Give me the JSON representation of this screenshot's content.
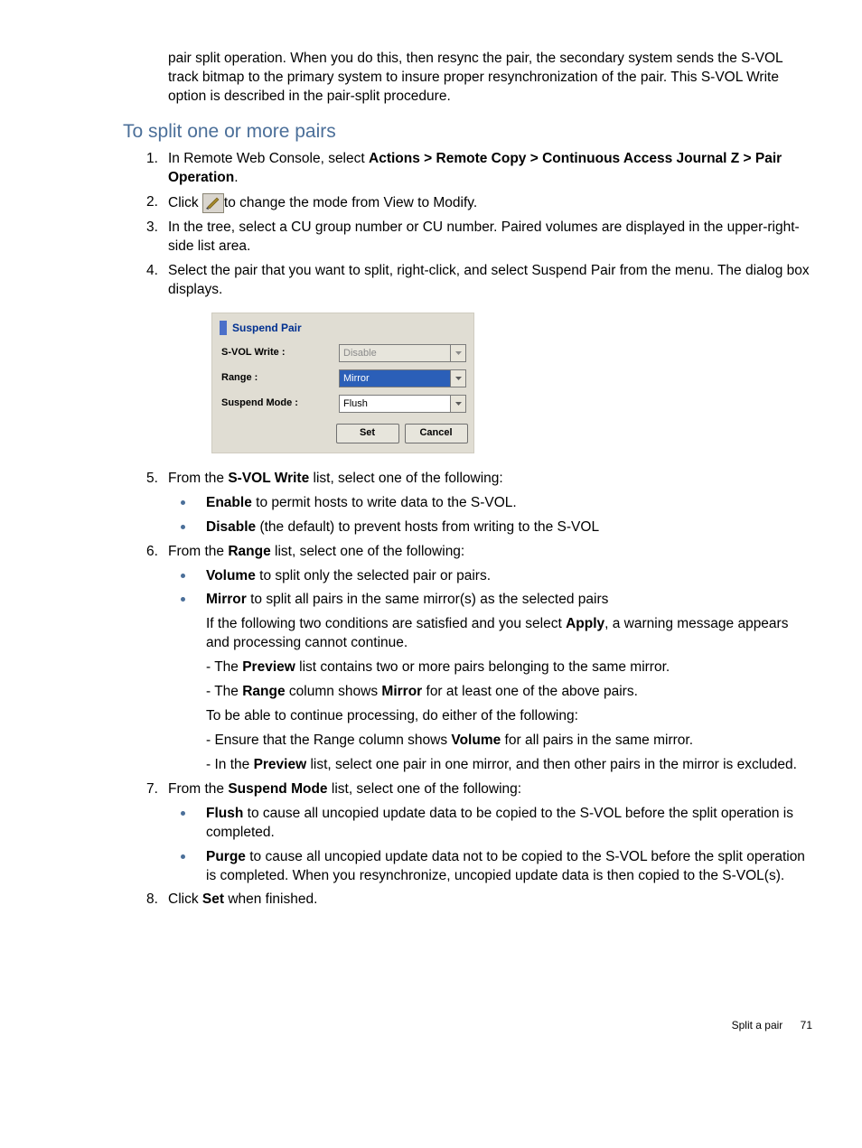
{
  "intro": "pair split operation. When you do this, then resync the pair, the secondary system sends the S-VOL track bitmap to the primary system to insure proper resynchronization of the pair. This S-VOL Write option is described in the pair-split procedure.",
  "heading": "To split one or more pairs",
  "steps": {
    "s1_a": "In Remote Web Console, select ",
    "s1_b": "Actions > Remote Copy > Continuous Access Journal Z > Pair Operation",
    "s1_c": ".",
    "s2_a": "Click ",
    "s2_b": "to change the mode from View to Modify.",
    "s3": "In the tree, select a CU group number or CU number. Paired volumes are displayed in the upper-right-side list area.",
    "s4": "Select the pair that you want to split, right-click, and select Suspend Pair from the menu. The dialog box displays.",
    "s5_a": "From the ",
    "s5_b": "S-VOL Write",
    "s5_c": " list, select one of the following:",
    "s5_enable_b": "Enable",
    "s5_enable_t": " to permit hosts to write data to the S-VOL.",
    "s5_disable_b": "Disable",
    "s5_disable_t": " (the default) to prevent hosts from writing to the S-VOL",
    "s6_a": "From the ",
    "s6_b": "Range",
    "s6_c": " list, select one of the following:",
    "s6_vol_b": "Volume",
    "s6_vol_t": " to split only the selected pair or pairs.",
    "s6_mir_b": "Mirror",
    "s6_mir_t": " to split all pairs in the same mirror(s) as the selected pairs",
    "s6_p1_a": "If the following two conditions are satisfied and you select ",
    "s6_p1_b": "Apply",
    "s6_p1_c": ", a warning message appears and processing cannot continue.",
    "s6_p2_a": "- The ",
    "s6_p2_b": "Preview",
    "s6_p2_c": " list contains two or more pairs belonging to the same mirror.",
    "s6_p3_a": "- The ",
    "s6_p3_b": "Range",
    "s6_p3_c": " column shows ",
    "s6_p3_d": "Mirror",
    "s6_p3_e": " for at least one of the above pairs.",
    "s6_p4": "To be able to continue processing, do either of the following:",
    "s6_p5_a": "- Ensure that the Range column shows ",
    "s6_p5_b": "Volume",
    "s6_p5_c": " for all pairs in the same mirror.",
    "s6_p6_a": "- In the ",
    "s6_p6_b": "Preview",
    "s6_p6_c": " list, select one pair in one mirror, and then other pairs in the mirror is excluded.",
    "s7_a": "From the ",
    "s7_b": "Suspend Mode",
    "s7_c": " list, select one of the following:",
    "s7_flush_b": "Flush",
    "s7_flush_t": " to cause all uncopied update data to be copied to the S-VOL before the split operation is completed.",
    "s7_purge_b": "Purge",
    "s7_purge_t": " to cause all uncopied update data not to be copied to the S-VOL before the split operation is completed. When you resynchronize, uncopied update data is then copied to the S-VOL(s).",
    "s8_a": "Click ",
    "s8_b": "Set",
    "s8_c": " when finished."
  },
  "dialog": {
    "title": "Suspend Pair",
    "row1_label": "S-VOL Write :",
    "row1_value": "Disable",
    "row2_label": "Range :",
    "row2_value": "Mirror",
    "row3_label": "Suspend Mode :",
    "row3_value": "Flush",
    "btn_set": "Set",
    "btn_cancel": "Cancel"
  },
  "footer": {
    "section": "Split a pair",
    "page": "71"
  }
}
